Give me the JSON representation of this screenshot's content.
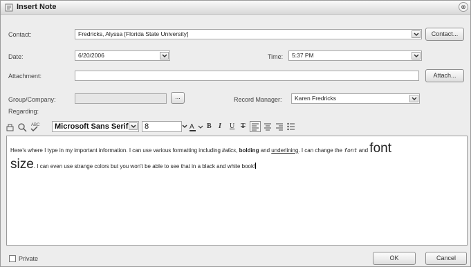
{
  "window": {
    "title": "Insert Note",
    "close_glyph": "⊗"
  },
  "form": {
    "contact_label": "Contact:",
    "contact_value": "Fredricks, Alyssa [Florida State University]",
    "contact_button": "Contact...",
    "date_label": "Date:",
    "date_value": "6/20/2006",
    "time_label": "Time:",
    "time_value": "5:37 PM",
    "attachment_label": "Attachment:",
    "attachment_value": "",
    "attach_button": "Attach...",
    "group_label": "Group/Company:",
    "group_value": "",
    "browse_button": "...",
    "record_manager_label": "Record Manager:",
    "record_manager_value": "Karen Fredricks",
    "regarding_label": "Regarding:"
  },
  "toolbar": {
    "font_name": "Microsoft Sans Serif",
    "font_size": "8",
    "bold": "B",
    "italic": "I",
    "underline": "U",
    "strike": "T",
    "icons": [
      "paste-icon",
      "find-icon",
      "spellcheck-icon",
      "font-color-icon",
      "align-left-icon",
      "align-center-icon",
      "align-right-icon",
      "bullets-icon"
    ]
  },
  "note": {
    "part1": "Here's where I type in my important information.  I can use various formatting including ",
    "italics": "italics",
    "sep1": ", ",
    "bolding": "bolding",
    "sep2": " and ",
    "underlining": "underlining",
    "part2": ".  I can change the ",
    "font_word": "font",
    "and_word": " and ",
    "font_big": "font",
    "size_big": "size",
    "part3": ".  I can even use strange colors but you won't be able to see that in a black and white book!"
  },
  "footer": {
    "private_label": "Private",
    "ok_button": "OK",
    "cancel_button": "Cancel"
  }
}
